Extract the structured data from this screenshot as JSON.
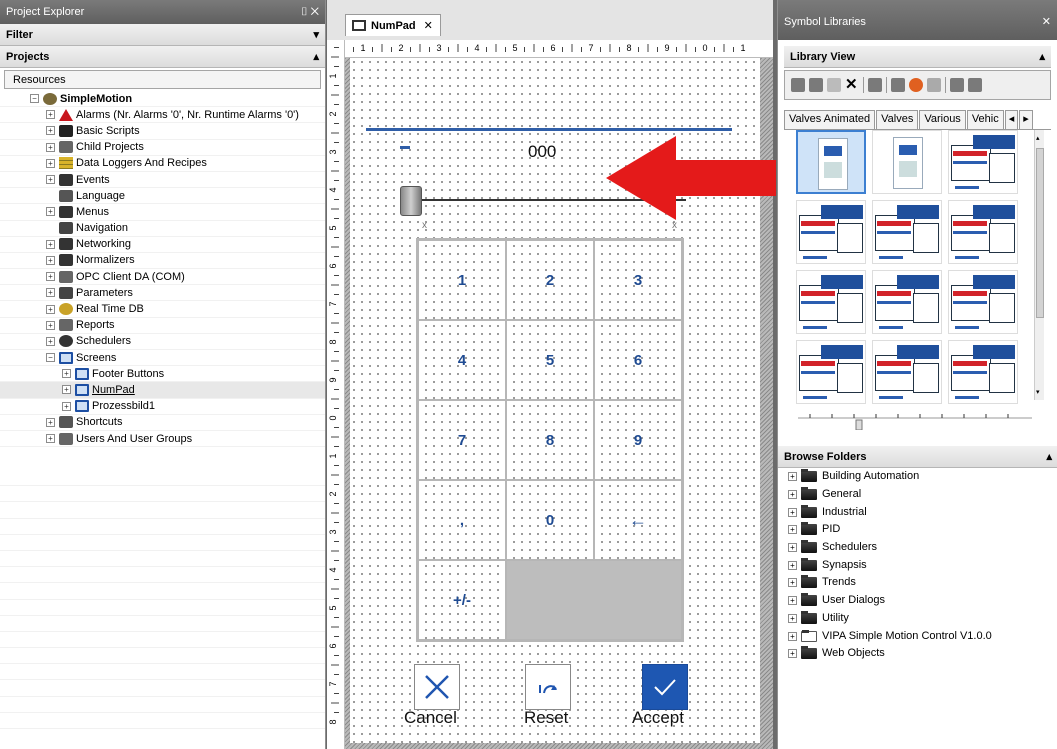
{
  "left_panel": {
    "title": "Project Explorer",
    "pin_close": "⌷ ✕",
    "filter_label": "Filter",
    "projects_label": "Projects",
    "resources_label": "Resources",
    "tree": [
      {
        "label": "SimpleMotion",
        "level": 0,
        "expander": "−",
        "icon": "gear-icon",
        "bold": true
      },
      {
        "label": "Alarms (Nr. Alarms '0', Nr. Runtime Alarms '0')",
        "level": 1,
        "expander": "+",
        "icon": "alarm-icon"
      },
      {
        "label": "Basic Scripts",
        "level": 1,
        "expander": "+",
        "icon": "script-icon"
      },
      {
        "label": "Child Projects",
        "level": 1,
        "expander": "+",
        "icon": "child-projects-icon"
      },
      {
        "label": "Data Loggers And Recipes",
        "level": 1,
        "expander": "+",
        "icon": "database-icon"
      },
      {
        "label": "Events",
        "level": 1,
        "expander": "+",
        "icon": "events-icon"
      },
      {
        "label": "Language",
        "level": 1,
        "expander": "",
        "icon": "language-icon"
      },
      {
        "label": "Menus",
        "level": 1,
        "expander": "+",
        "icon": "menu-icon"
      },
      {
        "label": "Navigation",
        "level": 1,
        "expander": "",
        "icon": "navigation-icon"
      },
      {
        "label": "Networking",
        "level": 1,
        "expander": "+",
        "icon": "networking-icon"
      },
      {
        "label": "Normalizers",
        "level": 1,
        "expander": "+",
        "icon": "normalizer-icon"
      },
      {
        "label": "OPC Client DA (COM)",
        "level": 1,
        "expander": "+",
        "icon": "opc-icon"
      },
      {
        "label": "Parameters",
        "level": 1,
        "expander": "+",
        "icon": "parameters-icon"
      },
      {
        "label": "Real Time DB",
        "level": 1,
        "expander": "+",
        "icon": "realtime-db-icon"
      },
      {
        "label": "Reports",
        "level": 1,
        "expander": "+",
        "icon": "reports-icon"
      },
      {
        "label": "Schedulers",
        "level": 1,
        "expander": "+",
        "icon": "scheduler-icon"
      },
      {
        "label": "Screens",
        "level": 1,
        "expander": "−",
        "icon": "screen-icon"
      },
      {
        "label": "Footer Buttons",
        "level": 2,
        "expander": "+",
        "icon": "screen-icon"
      },
      {
        "label": "NumPad",
        "level": 2,
        "expander": "+",
        "icon": "screen-icon",
        "selected": true
      },
      {
        "label": "Prozessbild1",
        "level": 2,
        "expander": "+",
        "icon": "screen-icon"
      },
      {
        "label": "Shortcuts",
        "level": 1,
        "expander": "+",
        "icon": "shortcuts-icon"
      },
      {
        "label": "Users And User Groups",
        "level": 1,
        "expander": "+",
        "icon": "users-icon"
      }
    ]
  },
  "editor": {
    "tab_label": "NumPad",
    "tab_close": "✕",
    "hruler_labels": [
      "1",
      "2",
      "3",
      "4",
      "5",
      "6",
      "7",
      "8",
      "9",
      "0",
      "1"
    ],
    "vruler_labels": [
      "1",
      "2",
      "3",
      "4",
      "5",
      "6",
      "7",
      "8",
      "9",
      "0",
      "1",
      "2",
      "3",
      "4",
      "5",
      "6",
      "7",
      "8"
    ],
    "display_value": "000",
    "slider_x_left": "x",
    "slider_x_right": "x",
    "keys": [
      "1",
      "2",
      "3",
      "4",
      "5",
      "6",
      "7",
      "8",
      "9",
      ",",
      "0",
      "←",
      "+/-"
    ],
    "cancel_label": "Cancel",
    "reset_label": "Reset",
    "accept_label": "Accept"
  },
  "right_panel": {
    "title": "Symbol Libraries",
    "close": "✕",
    "library_view_label": "Library View",
    "tabs": [
      "Valves Animated",
      "Valves",
      "Various",
      "Vehic"
    ],
    "tab_scroll_left": "◂",
    "tab_scroll_right": "▸",
    "browse_folders_label": "Browse Folders",
    "folders": [
      "Building Automation",
      "General",
      "Industrial",
      "PID",
      "Schedulers",
      "Synapsis",
      "Trends",
      "User Dialogs",
      "Utility",
      "VIPA Simple Motion Control V1.0.0",
      "Web Objects"
    ]
  },
  "colors": {
    "accent_blue": "#1e57b2",
    "annotation_red": "#e41a1a"
  }
}
